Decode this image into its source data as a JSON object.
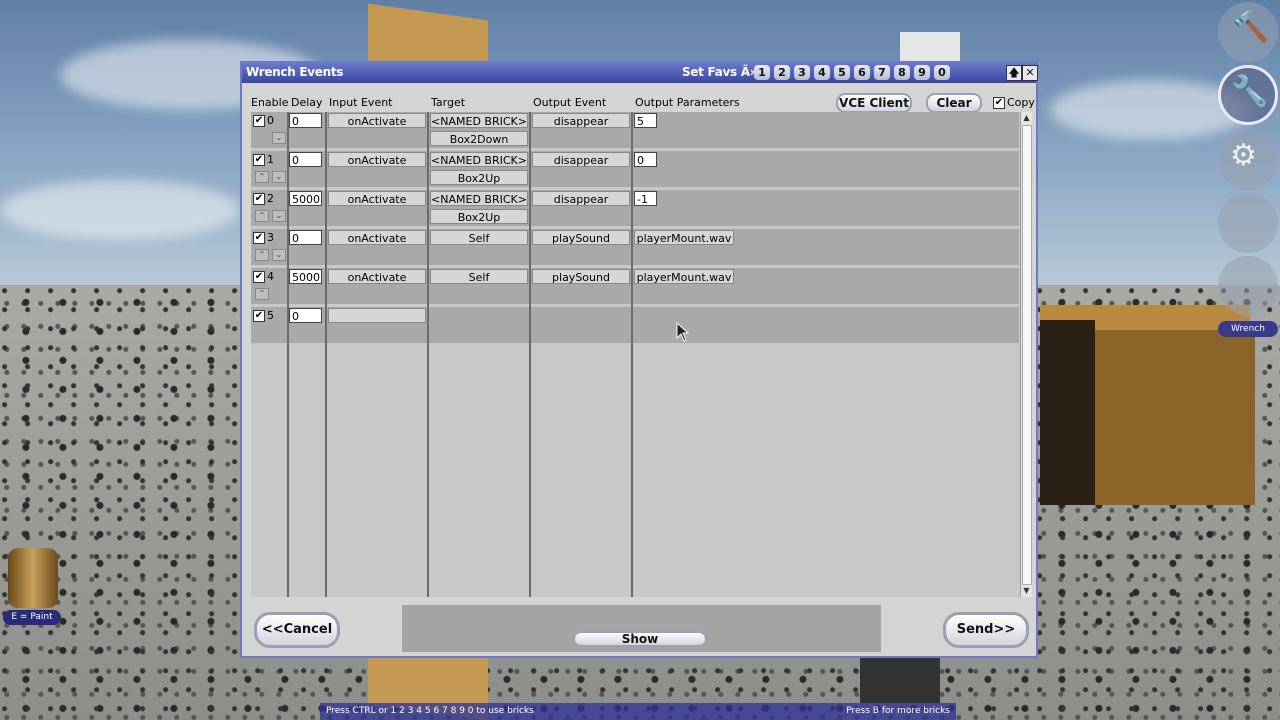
{
  "window": {
    "title": "Wrench Events",
    "set_favs_label": "Set Favs Ã»",
    "favs": [
      "1",
      "2",
      "3",
      "4",
      "5",
      "6",
      "7",
      "8",
      "9",
      "0"
    ],
    "up_glyph": "🡅",
    "close_glyph": "✕"
  },
  "headers": {
    "enable": "Enable",
    "delay": "Delay",
    "input_event": "Input Event",
    "target": "Target",
    "output_event": "Output Event",
    "output_parameters": "Output Parameters"
  },
  "toolbar": {
    "vce_client": "VCE Client",
    "clear": "Clear",
    "copy": "Copy",
    "copy_checked": "✔"
  },
  "events": [
    {
      "index": "0",
      "enabled": "✔",
      "delay": "0",
      "input": "onActivate",
      "target": "<NAMED BRICK>",
      "target_name": "Box2Down",
      "output": "disappear",
      "param": "5",
      "up": "",
      "down": "⌄"
    },
    {
      "index": "1",
      "enabled": "✔",
      "delay": "0",
      "input": "onActivate",
      "target": "<NAMED BRICK>",
      "target_name": "Box2Up",
      "output": "disappear",
      "param": "0",
      "up": "⌃",
      "down": "⌄"
    },
    {
      "index": "2",
      "enabled": "✔",
      "delay": "5000",
      "input": "onActivate",
      "target": "<NAMED BRICK>",
      "target_name": "Box2Up",
      "output": "disappear",
      "param": "-1",
      "up": "⌃",
      "down": "⌄"
    },
    {
      "index": "3",
      "enabled": "✔",
      "delay": "0",
      "input": "onActivate",
      "target": "Self",
      "target_name": "",
      "output": "playSound",
      "param": "playerMount.wav",
      "up": "⌃",
      "down": "⌄"
    },
    {
      "index": "4",
      "enabled": "✔",
      "delay": "5000",
      "input": "onActivate",
      "target": "Self",
      "target_name": "",
      "output": "playSound",
      "param": "playerMount.wav",
      "up": "⌃",
      "down": ""
    },
    {
      "index": "5",
      "enabled": "✔",
      "delay": "0",
      "input": "",
      "target": "",
      "target_name": "",
      "output": "",
      "param": "",
      "up": "",
      "down": ""
    }
  ],
  "footer": {
    "cancel": "<<Cancel",
    "show": "Show",
    "send": "Send>>"
  },
  "hud": {
    "tool_label": "Wrench",
    "paint_label": "E = Paint",
    "hint_left": "Press CTRL or 1 2 3 4 5 6 7 8 9 0 to use bricks",
    "hint_right": "Press B for more bricks"
  },
  "colors": {
    "title_bar": "#3a46a0",
    "dialog_bg": "#d4d4d4",
    "row_bg": "#a9a9a9"
  }
}
